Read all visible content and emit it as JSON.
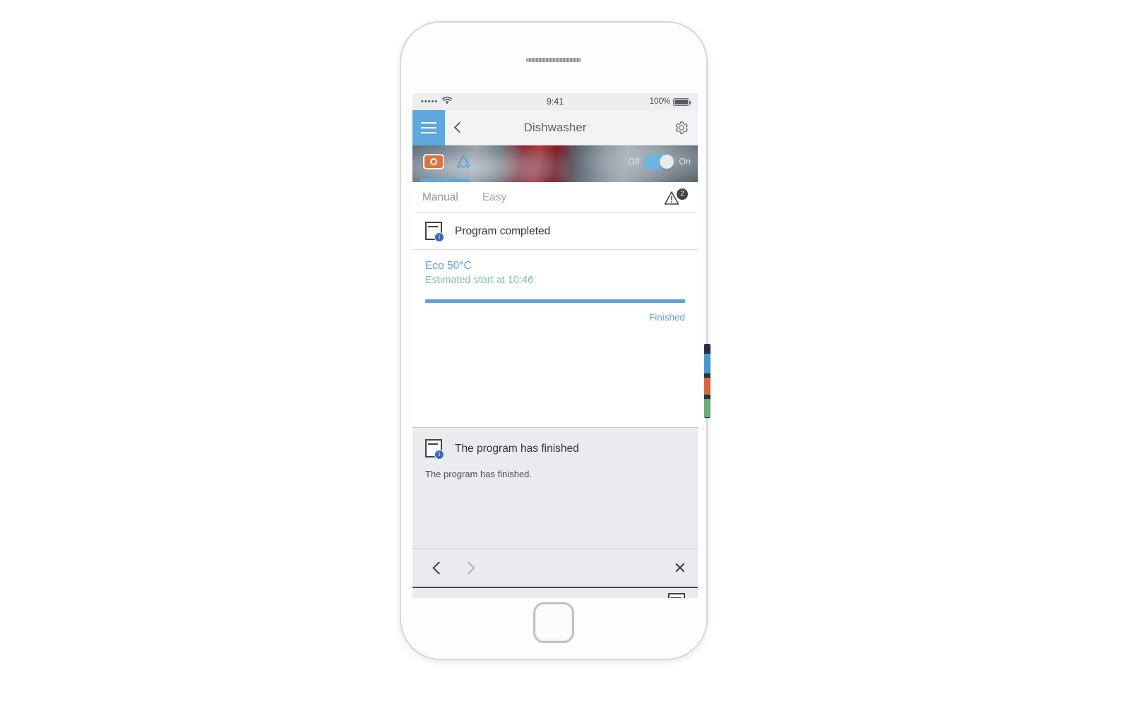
{
  "status_bar": {
    "signal_dots": "•••••",
    "wifi_icon": "wifi-icon",
    "time": "9:41",
    "battery_percent": "100%"
  },
  "nav_bar": {
    "menu_icon": "hamburger-icon",
    "back_icon": "chevron-left-icon",
    "title": "Dishwasher",
    "settings_icon": "gear-icon"
  },
  "hero": {
    "program_icon": "program-selector-icon",
    "water_icon": "water-drop-icon",
    "toggle_off_label": "Off",
    "toggle_on_label": "On",
    "toggle_state": "on"
  },
  "tabs": {
    "items": [
      {
        "label": "Manual",
        "active": true
      },
      {
        "label": "Easy",
        "active": false
      }
    ],
    "warning_icon": "warning-triangle-icon",
    "warning_count": "2"
  },
  "status_row": {
    "icon": "dishwasher-info-icon",
    "text": "Program completed"
  },
  "program": {
    "name": "Eco 50°C",
    "estimate": "Estimated start at 10:46",
    "progress_percent": 100,
    "state_label": "Finished"
  },
  "notification": {
    "icon": "dishwasher-info-icon",
    "title": "The program has finished",
    "body": "The program has finished.",
    "prev_icon": "chevron-left-icon",
    "next_icon": "chevron-right-icon",
    "close_icon": "close-icon"
  },
  "bottom_strip": {
    "icon": "dishwasher-info-icon"
  },
  "colors": {
    "accent_blue": "#5fa8dd",
    "program_blue": "#5fa0d8",
    "estimate_green": "#7ec4a7",
    "orange": "#e0733c",
    "panel_gray": "#e9ebee"
  }
}
